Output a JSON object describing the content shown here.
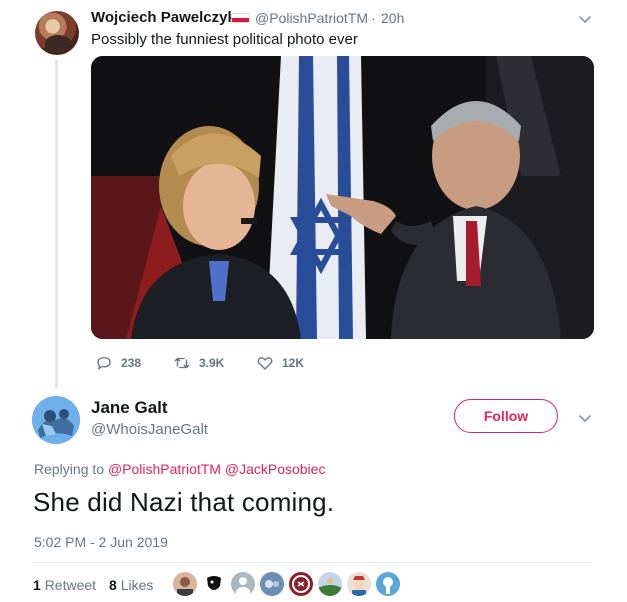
{
  "parent_tweet": {
    "display_name": "Wojciech Pawelczyk",
    "flag_icon": "poland-flag-icon",
    "handle": "@PolishPatriotTM",
    "separator": "·",
    "time": "20h",
    "text": "Possibly the funniest political photo ever",
    "actions": {
      "replies": "238",
      "retweets": "3.9K",
      "likes": "12K"
    }
  },
  "main_tweet": {
    "display_name": "Jane Galt",
    "handle": "@WhoisJaneGalt",
    "follow_label": "Follow",
    "replying_prefix": "Replying to",
    "replying_mentions": [
      "@PolishPatriotTM",
      "@JackPosobiec"
    ],
    "text": "She did Nazi that coming.",
    "timestamp": "5:02 PM - 2 Jun 2019",
    "retweet_count": "1",
    "retweet_label": "Retweet",
    "like_count": "8",
    "like_label": "Likes"
  },
  "colors": {
    "accent": "#e0245e",
    "muted": "#657786",
    "text": "#14171a",
    "border": "#e6ecf0"
  }
}
